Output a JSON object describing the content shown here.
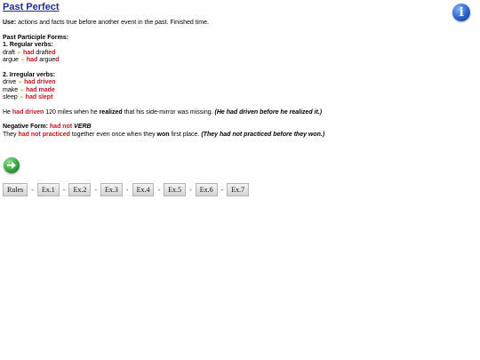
{
  "title": "Past Perfect",
  "info_label": "i",
  "use": {
    "label": "Use:",
    "text": " actions and facts true before another event in the past. Finished time."
  },
  "forms": {
    "heading": "Past Participle Forms:",
    "regular_heading": "1. Regular verbs:",
    "regular": [
      {
        "base": "draft",
        "had": "had",
        "pp_stem": "draft",
        "pp_suffix": "ed"
      },
      {
        "base": "argue",
        "had": "had",
        "pp_stem": "argue",
        "pp_suffix": "d"
      }
    ],
    "irregular_heading": "2. Irregular verbs:",
    "irregular": [
      {
        "base": "drive",
        "had": "had",
        "pp": "driven"
      },
      {
        "base": "make",
        "had": "had",
        "pp": "made"
      },
      {
        "base": "sleep",
        "had": "had",
        "pp": "slept"
      }
    ]
  },
  "example": {
    "he": "He ",
    "had_driven": "had driven",
    "mid": " 120 miles when he ",
    "realized": "realized",
    "tail": " that his side-mirror was missing. ",
    "note": "(He had driven before he realized it.)"
  },
  "negative": {
    "label": "Negative Form: ",
    "had_not": "had not",
    "verb": "VERB",
    "they": "They ",
    "had_not_practiced": "had not practiced",
    "mid": " together even once when they ",
    "won": "won",
    "tail": " first place. ",
    "note": "(They had not practiced before they won.)"
  },
  "arrow_glyph": "➢",
  "tabs": [
    "Rules",
    "Ex.1",
    "Ex.2",
    "Ex.3",
    "Ex.4",
    "Ex.5",
    "Ex.6",
    "Ex.7"
  ],
  "tab_separator": "-",
  "colors": {
    "title": "#1f2f8f",
    "highlight": "#c0141b",
    "arrow": "#e0a020",
    "info_button": "#2a62c9",
    "next_button": "#2f9c38"
  },
  "icons": {
    "info": "info-icon",
    "next": "arrow-right-icon"
  }
}
